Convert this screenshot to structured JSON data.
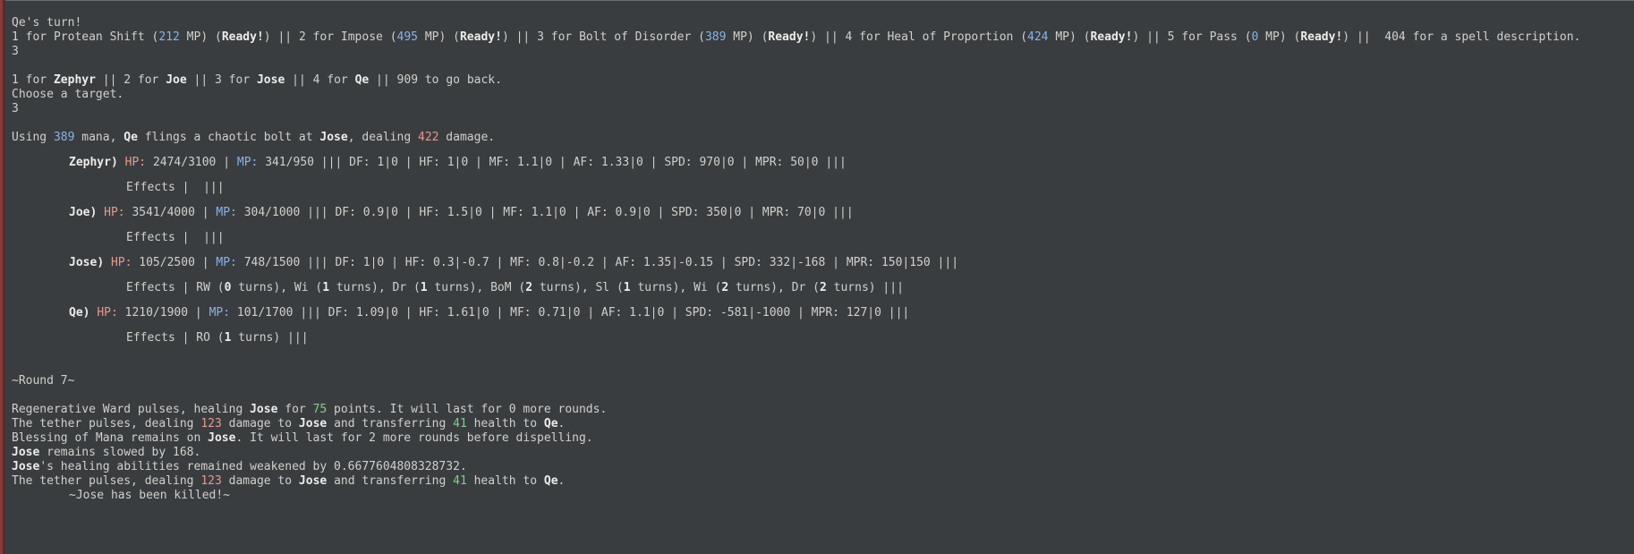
{
  "turn": "Qe's turn!",
  "spells": [
    {
      "num": "1",
      "name": "Protean Shift",
      "mp": "212",
      "status": "Ready!"
    },
    {
      "num": "2",
      "name": "Impose",
      "mp": "495",
      "status": "Ready!"
    },
    {
      "num": "3",
      "name": "Bolt of Disorder",
      "mp": "389",
      "status": "Ready!"
    },
    {
      "num": "4",
      "name": "Heal of Proportion",
      "mp": "424",
      "status": "Ready!"
    },
    {
      "num": "5",
      "name": "Pass",
      "mp": "0",
      "status": "Ready!"
    }
  ],
  "spell_desc": "404 for a spell description.",
  "input1": "3",
  "targets": [
    {
      "num": "1",
      "name": "Zephyr"
    },
    {
      "num": "2",
      "name": "Joe"
    },
    {
      "num": "3",
      "name": "Jose"
    },
    {
      "num": "4",
      "name": "Qe"
    }
  ],
  "go_back": "909 to go back.",
  "choose": "Choose a target.",
  "input2": "3",
  "cast": {
    "mana": "389",
    "caster": "Qe",
    "action": "flings a chaotic bolt at",
    "target": "Jose",
    "damage": "422"
  },
  "characters": [
    {
      "name": "Zephyr",
      "hp": "2474/3100",
      "mp": "341/950",
      "stats": "DF: 1|0 | HF: 1|0 | MF: 1.1|0 | AF: 1.33|0 | SPD: 970|0 | MPR: 50|0 |||",
      "effects": []
    },
    {
      "name": "Joe",
      "hp": "3541/4000",
      "mp": "304/1000",
      "stats": "DF: 0.9|0 | HF: 1.5|0 | MF: 1.1|0 | AF: 0.9|0 | SPD: 350|0 | MPR: 70|0 |||",
      "effects": []
    },
    {
      "name": "Jose",
      "hp": "105/2500",
      "mp": "748/1500",
      "stats": "DF: 1|0 | HF: 0.3|-0.7 | MF: 0.8|-0.2 | AF: 1.35|-0.15 | SPD: 332|-168 | MPR: 150|150 |||",
      "effects": [
        {
          "n": "RW",
          "t": "0"
        },
        {
          "n": "Wi",
          "t": "1"
        },
        {
          "n": "Dr",
          "t": "1"
        },
        {
          "n": "BoM",
          "t": "2"
        },
        {
          "n": "Sl",
          "t": "1"
        },
        {
          "n": "Wi",
          "t": "2"
        },
        {
          "n": "Dr",
          "t": "2"
        }
      ]
    },
    {
      "name": "Qe",
      "hp": "1210/1900",
      "mp": "101/1700",
      "stats": "DF: 1.09|0 | HF: 1.61|0 | MF: 0.71|0 | AF: 1.1|0 | SPD: -581|-1000 | MPR: 127|0 |||",
      "effects": [
        {
          "n": "RO",
          "t": "1"
        }
      ]
    }
  ],
  "round": "~Round 7~",
  "log": {
    "l1": {
      "a": "Regenerative Ward pulses, healing",
      "who": "Jose",
      "b": "for",
      "amt": "75",
      "c": "points. It will last for 0 more rounds."
    },
    "l2": {
      "a": "The tether pulses, dealing",
      "amt": "123",
      "b": "damage to",
      "who": "Jose",
      "c": "and transferring",
      "amt2": "41",
      "d": "health to",
      "who2": "Qe",
      "e": "."
    },
    "l3": {
      "a": "Blessing of Mana remains on",
      "who": "Jose",
      "b": ". It will last for 2 more rounds before dispelling."
    },
    "l4": {
      "who": "Jose",
      "a": "remains slowed by 168."
    },
    "l5": {
      "who": "Jose",
      "a": "'s healing abilities remained weakened by 0.6677604808328732."
    },
    "l6": {
      "a": "The tether pulses, dealing",
      "amt": "123",
      "b": "damage to",
      "who": "Jose",
      "c": "and transferring",
      "amt2": "41",
      "d": "health to",
      "who2": "Qe",
      "e": "."
    },
    "killed": "~Jose has been killed!~"
  }
}
